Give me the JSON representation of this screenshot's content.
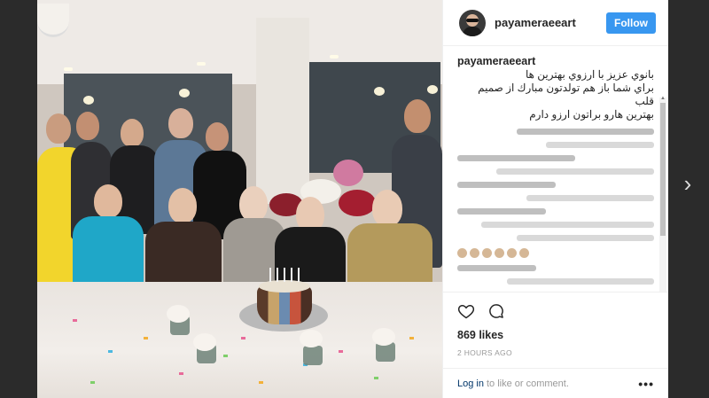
{
  "post": {
    "username": "payameraeeart",
    "follow_label": "Follow",
    "caption_user": "payameraeeart",
    "caption_text": "بانوي عزيز با ارزوي بهترين ها\nبراي شما باز هم تولدتون مبارك از صميم قلب\nبهترين هارو براتون ارزو دارم",
    "likes": "869 likes",
    "timestamp": "2 HOURS AGO",
    "login_link": "Log in",
    "login_suffix": "to like or comment.",
    "more_icon_text": "•••"
  },
  "icons": {
    "heart": "heart-icon",
    "comment": "comment-icon",
    "next": "chevron-right-icon",
    "more": "more-options-icon"
  },
  "nav": {
    "next_glyph": "›"
  },
  "colors": {
    "follow_button": "#3897f0",
    "link": "#003569",
    "overlay": "#262626"
  }
}
